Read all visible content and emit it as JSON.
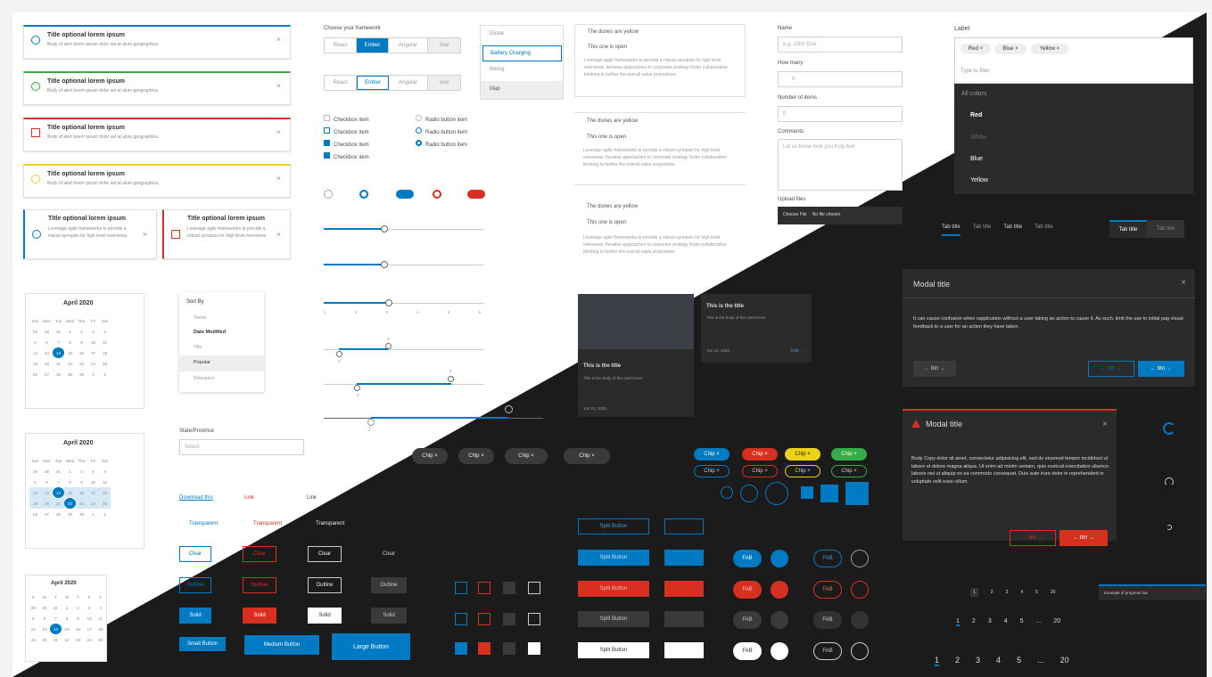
{
  "colors": {
    "blue": "#007ac2",
    "red": "#d83020",
    "green": "#35ac46",
    "yellow": "#edd317",
    "dark": "#1b1b1b",
    "darkpanel": "#2b2b2b"
  },
  "alerts": {
    "title": "Title optional lorem ipsum",
    "body": "Body of alert lorem ipsum dolor set at alum geographica.",
    "long_body": "Leverage agile frameworks to provide a robust synopsis for high level overviews.",
    "close": "×",
    "icons": [
      "info-icon",
      "check-circle-icon",
      "warning-icon",
      "lightbulb-icon"
    ]
  },
  "framework": {
    "label": "Choose your framework",
    "options": [
      "React",
      "Ember",
      "Angular",
      "Vue"
    ],
    "selected": "Ember"
  },
  "menu": {
    "items": [
      "Globe",
      "Battery Charging",
      "Biking",
      "Map"
    ]
  },
  "checkbox": {
    "items": [
      "Checkbox item",
      "Checkbox item",
      "Checkbox item",
      "Checkbox item"
    ]
  },
  "radio": {
    "items": [
      "Radio button item",
      "Radio button item",
      "Radio button item"
    ]
  },
  "accordion": {
    "h1": "The dunes are yellow",
    "h2": "This one is open",
    "body": "Leverage agile frameworks to provide a robust synopsis for high level overviews. Iterative approaches to corporate strategy foster collaborative thinking to further the overall value proposition."
  },
  "form": {
    "name_label": "Name",
    "name_placeholder": "e.g. John Doe",
    "how_many_label": "How many",
    "how_many_value": "0",
    "items_label": "Number of items",
    "items_value": "0",
    "comments_label": "Comments",
    "comments_placeholder": "Let us know how you truly feel",
    "upload_label": "Upload files",
    "choose_file": "Choose File",
    "no_file": "No file chosen",
    "state_label": "State/Province",
    "state_placeholder": "Select"
  },
  "combobox": {
    "label": "Label",
    "chips": [
      "Red",
      "Blue",
      "Yellow"
    ],
    "filter_placeholder": "Type to filter",
    "options": [
      "All colors",
      "Red",
      "White",
      "Blue",
      "Yellow"
    ]
  },
  "tabs": {
    "label": "Tab title"
  },
  "slider": {
    "ticks": [
      "1",
      "2",
      "3",
      "4",
      "5",
      "6"
    ],
    "markers": [
      "2",
      "3",
      "4",
      "5",
      "2"
    ]
  },
  "calendar": {
    "month": "April 2020",
    "days": [
      "Sun",
      "Mon",
      "Tue",
      "Wed",
      "Thu",
      "Fri",
      "Sat"
    ],
    "short_days": [
      "S",
      "M",
      "T",
      "W",
      "T",
      "F",
      "S"
    ],
    "rows": [
      [
        "29",
        "30",
        "31",
        "1",
        "2",
        "3",
        "4"
      ],
      [
        "5",
        "6",
        "7",
        "8",
        "9",
        "10",
        "11"
      ],
      [
        "12",
        "13",
        "14",
        "15",
        "16",
        "17",
        "18"
      ],
      [
        "19",
        "20",
        "21",
        "22",
        "23",
        "24",
        "25"
      ],
      [
        "26",
        "27",
        "28",
        "29",
        "30",
        "1",
        "2"
      ]
    ]
  },
  "sort": {
    "title": "Sort By",
    "items": [
      "Owner",
      "Date Modified",
      "Title",
      "Popular",
      "Relevance"
    ]
  },
  "cards": {
    "title": "This is the title",
    "body": "This is the body of the card lorem",
    "date": "Jan 10, 2020",
    "link": "Link →"
  },
  "modal": {
    "title": "Modal title",
    "body": "It can cause confusion when rapplication without a user taking an action to cause it. As such, limit the use to initial pag visual feedback to a user for an action they have taken.",
    "danger_body": "Body Copy dolor sit amet, consectetur adipisicing elit, sed do eiusmod tempor incididunt ut labore et dolore magna aliqua. Ut enim ad minim veniam, quis nostrud exercitation ullamco laboris nisi ut aliquip ex ea commodo consequat. Duis aute irure dolor in reprehenderit in voluptate velit esse cillum.",
    "btn": "← btn →",
    "close": "×"
  },
  "chips": {
    "label": "Chip ×"
  },
  "links": {
    "download": "Download this",
    "link": "Link",
    "transparent": "Transparent"
  },
  "buttons": {
    "clear": "Clear",
    "outline": "Outline",
    "solid": "Solid",
    "small": "Small Button",
    "medium": "Medium Button",
    "large": "Large Button"
  },
  "split": {
    "label": "Split Button"
  },
  "fab": {
    "label": "FAB"
  },
  "pagination": {
    "pages": [
      "1",
      "2",
      "3",
      "4",
      "5",
      "...",
      "20"
    ],
    "progress_label": "Example of progress bar"
  }
}
